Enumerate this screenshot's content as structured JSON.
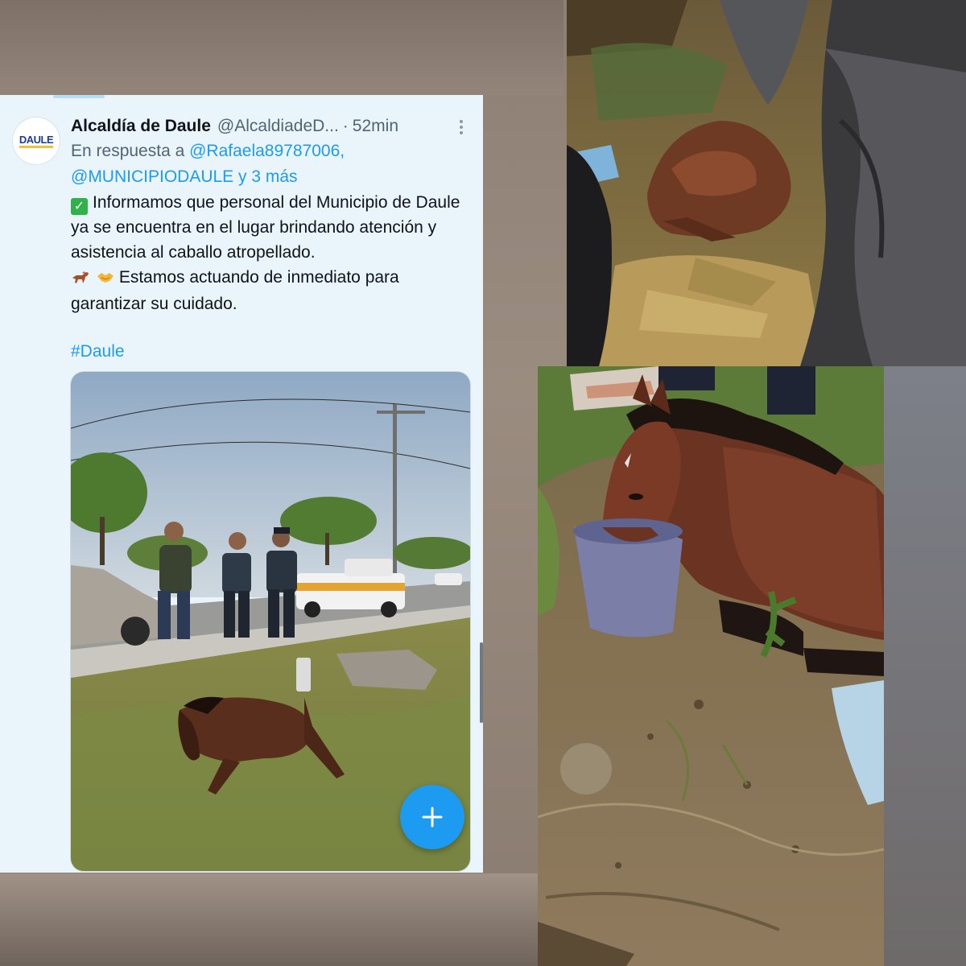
{
  "tweet": {
    "display_name": "Alcaldía de Daule",
    "handle": "@AlcaldiadeD...",
    "separator": "·",
    "time": "52min",
    "avatar_text": "DAULE",
    "reply_prefix": "En respuesta a",
    "reply_mention_1": "@Rafaela89787006,",
    "reply_mention_2": "@MUNICIPIODAULE",
    "reply_suffix": "y 3 más",
    "body_line_1": "Informamos que personal del Municipio de Daule ya se encuentra en el lugar brindando atención y asistencia al caballo atropellado.",
    "body_line_2": "Estamos actuando de inmediato para garantizar su cuidado.",
    "hashtag": "#Daule",
    "media_alt": "Foto: funcionarios junto a un caballo herido al borde de la carretera"
  },
  "icons": {
    "check": "check-mark-button-emoji",
    "horse": "horse-racing-emoji",
    "handshake": "handshake-emoji",
    "more": "more-vertical-icon",
    "compose": "plus-icon"
  },
  "colors": {
    "accent": "#1d9bf0",
    "card_bg": "#eaf4fb",
    "text": "#0f1419",
    "secondary": "#536471"
  }
}
